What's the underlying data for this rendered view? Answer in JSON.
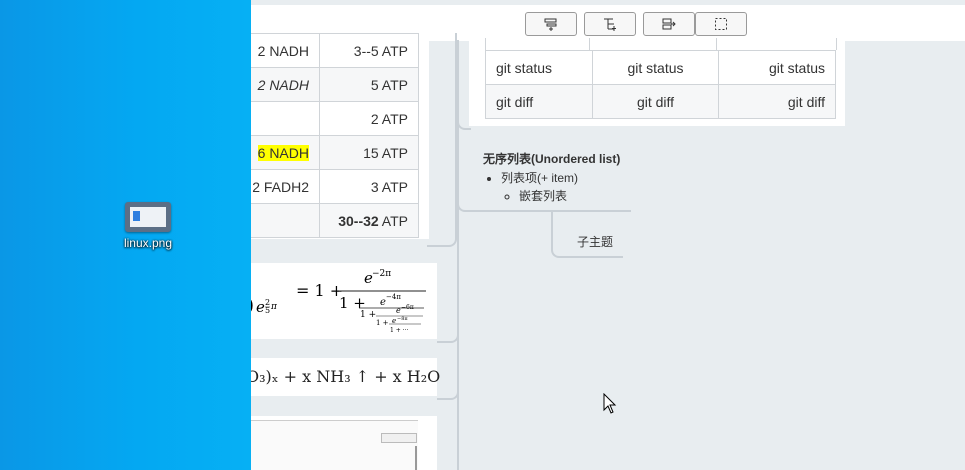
{
  "desktop": {
    "icon_label": "linux.png"
  },
  "toolbar": {
    "buttons": [
      "insert-topic-icon",
      "insert-subtopic-icon",
      "insert-parent-icon",
      "select-frame-icon"
    ]
  },
  "atp_table": {
    "rows": [
      {
        "a": "2 NADH",
        "b": "3--5 ATP",
        "italic": false,
        "highlight": false
      },
      {
        "a": "2 NADH",
        "b": "5 ATP",
        "italic": true,
        "highlight": false
      },
      {
        "a": "",
        "b": "2 ATP",
        "italic": false,
        "highlight": false
      },
      {
        "a": "6 NADH",
        "b": "15 ATP",
        "italic": false,
        "highlight": true
      },
      {
        "a": "2 FADH2",
        "b": "3 ATP",
        "italic": false,
        "highlight": false
      }
    ],
    "total_bold": "30--32",
    "total_unit": " ATP"
  },
  "git_table": {
    "rows": [
      [
        "git status",
        "git status",
        "git status"
      ],
      [
        "git diff",
        "git diff",
        "git diff"
      ]
    ]
  },
  "math1": {
    "lhs_tail": ")",
    "lhs_exp": "e",
    "eq": "= 1 +",
    "num": "e",
    "num_exp": "−2π",
    "den": "1 +",
    "n2": "e",
    "n2exp": "−4π",
    "d2": "1 +",
    "n3": "e",
    "n3exp": "−6π",
    "d3": "1 +",
    "n4": "e",
    "n4exp": "−8π",
    "d4": "1 + ···"
  },
  "math2": {
    "text": "O₃)ₓ + x NH₃ ↑ + x H₂O"
  },
  "list": {
    "title": "无序列表(Unordered list)",
    "item": "列表项(+ item)",
    "nested": "嵌套列表"
  },
  "subtopic": "子主题"
}
